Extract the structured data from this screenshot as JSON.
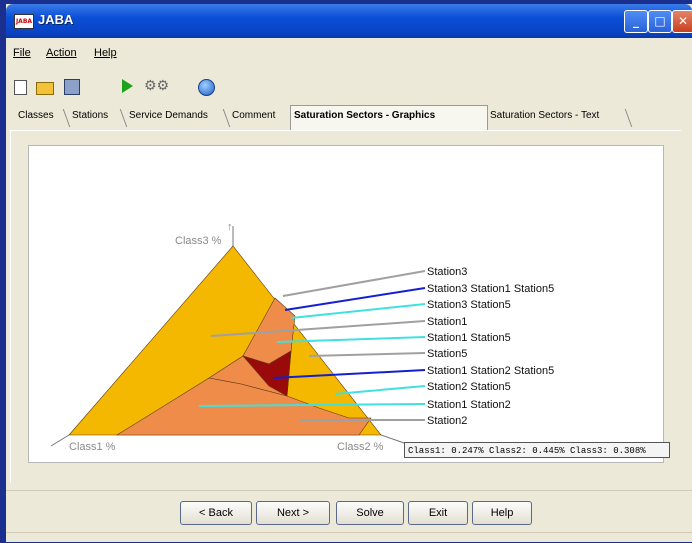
{
  "window": {
    "title": "JABA"
  },
  "menu": {
    "file": "File",
    "action": "Action",
    "help": "Help"
  },
  "toolbar": {
    "icons": [
      "new-file-icon",
      "open-folder-icon",
      "save-icon",
      "run-icon",
      "solve-icon",
      "help-icon"
    ]
  },
  "tabs": [
    {
      "label": "Classes"
    },
    {
      "label": "Stations"
    },
    {
      "label": "Service Demands"
    },
    {
      "label": "Comment"
    },
    {
      "label": "Saturation Sectors - Graphics",
      "active": true
    },
    {
      "label": "Saturation Sectors - Text"
    }
  ],
  "plot": {
    "axis_top": "Class3 %",
    "axis_left": "Class1 %",
    "axis_right": "Class2 %",
    "legend": [
      "Station3",
      "Station3 Station1 Station5",
      "Station3 Station5",
      "Station1",
      "Station1 Station5",
      "Station5",
      "Station1 Station2 Station5",
      "Station2 Station5",
      "Station1 Station2",
      "Station2"
    ],
    "colors": {
      "main": "#f5b800",
      "sector": "#f08c4a",
      "dark": "#9b0a0a",
      "line_grey": "#a0a0a0",
      "line_blue": "#1420d0",
      "line_cyan": "#40e0e0"
    },
    "readout": "Class1: 0.247% Class2: 0.445% Class3: 0.308%"
  },
  "buttons": {
    "back": "< Back",
    "next": "Next >",
    "solve": "Solve",
    "exit": "Exit",
    "help": "Help"
  },
  "window_controls": {
    "minimize": "_",
    "maximize": "□",
    "close": "✕"
  }
}
